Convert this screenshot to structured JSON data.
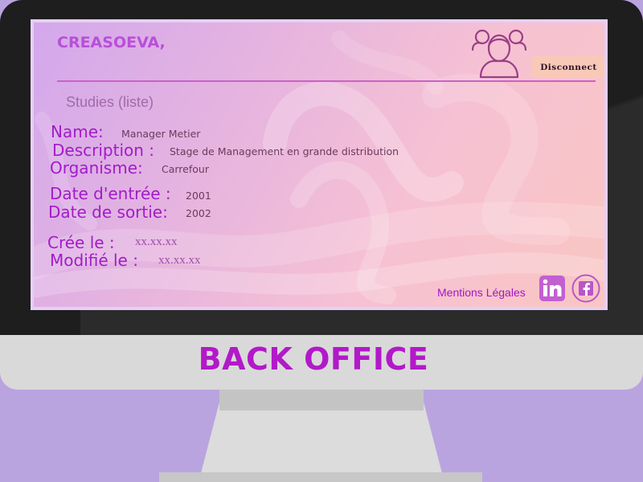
{
  "screen": {
    "brand": "CREASOEVA,",
    "disconnect_label": "Disconnect",
    "user_icon": "user-group-icon",
    "section_title": "Studies (liste)",
    "fields": {
      "name": {
        "label": "Name:",
        "value": "Manager Metier"
      },
      "description": {
        "label": "Description :",
        "value": "Stage de Management en grande distribution"
      },
      "organisme": {
        "label": "Organisme:",
        "value": "Carrefour"
      },
      "date_entree": {
        "label": "Date d'entrée :",
        "value": "2001"
      },
      "date_sortie": {
        "label": "Date de sortie:",
        "value": "2002"
      }
    },
    "meta": {
      "created": {
        "label": "Crée le :",
        "value": "xx.xx.xx"
      },
      "modified": {
        "label": "Modifié le :",
        "value": "xx.xx.xx"
      }
    },
    "footer": {
      "legal_link": "Mentions Légales",
      "linkedin_icon": "linkedin-icon",
      "facebook_icon": "facebook-icon"
    }
  },
  "monitor": {
    "title": "BACK OFFICE"
  },
  "colors": {
    "accent": "#a11cc8",
    "brand": "#b94fd8",
    "title": "#b219c9",
    "background": "#b9a4e0"
  }
}
